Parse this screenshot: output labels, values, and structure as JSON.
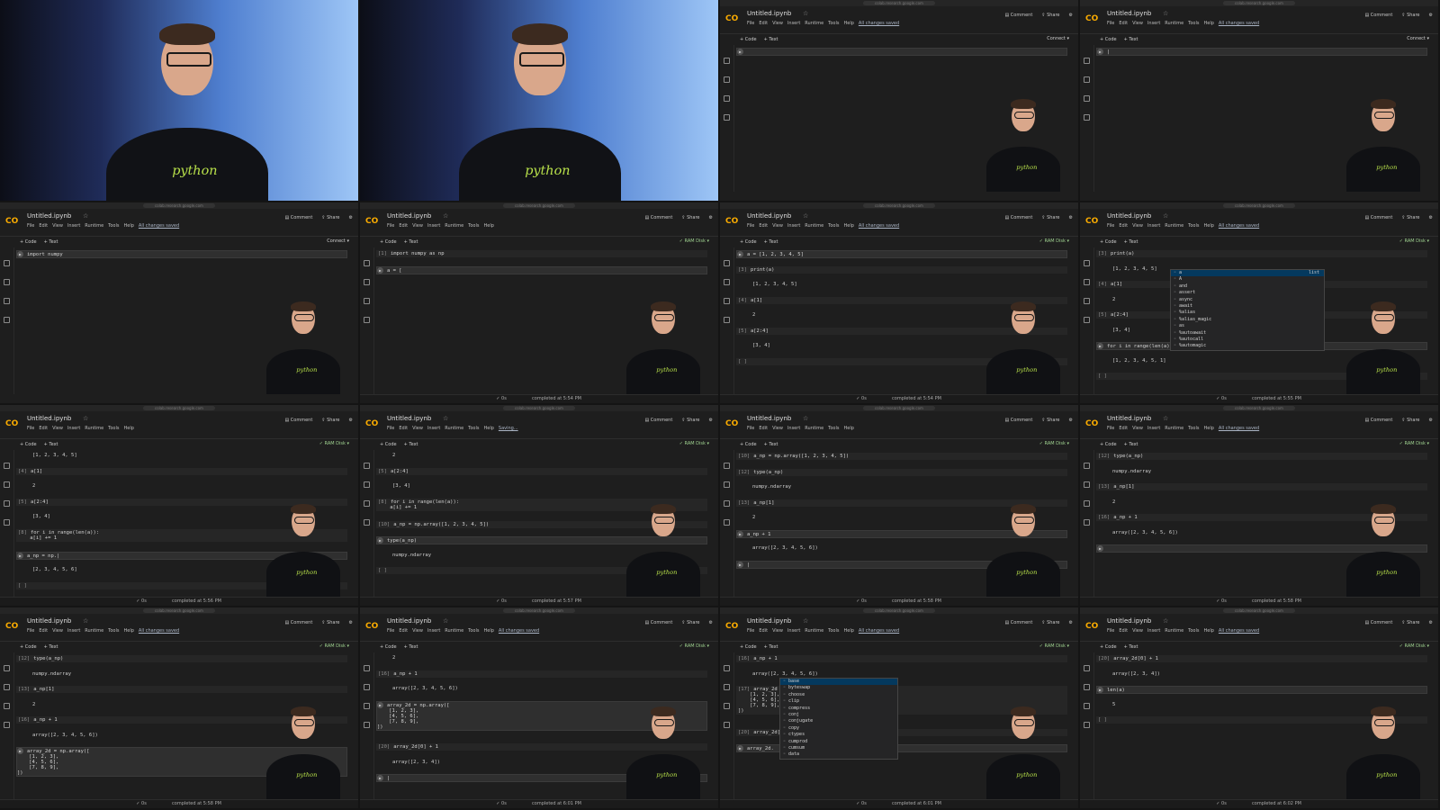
{
  "colab": {
    "title": "Untitled.ipynb",
    "star": "☆",
    "menu": [
      "File",
      "Edit",
      "View",
      "Insert",
      "Runtime",
      "Tools",
      "Help"
    ],
    "toolbar": [
      "+ Code",
      "+ Text"
    ],
    "comment": "Comment",
    "share": "Share",
    "gear": "⚙",
    "ram": "RAM Disk",
    "logo_text": "CO",
    "url": "colab.research.google.com"
  },
  "colors": {
    "accent": "#f9ab00",
    "bg": "#1e1e1e",
    "logo_green": "#b8e04a"
  },
  "frames": [
    {
      "type": "camera",
      "person_x": 0.52
    },
    {
      "type": "camera",
      "person_x": 0.5
    },
    {
      "type": "screen",
      "saved": "All changes saved",
      "connect": "Connect",
      "status": "",
      "time": "",
      "lines": [
        {
          "kind": "active",
          "text": ""
        }
      ]
    },
    {
      "type": "screen",
      "saved": "All changes saved",
      "connect": "Connect",
      "status": "",
      "time": "",
      "lines": [
        {
          "kind": "active",
          "text": "|"
        }
      ]
    },
    {
      "type": "screen",
      "saved": "All changes saved",
      "connect": "Connect",
      "status": "",
      "time": "",
      "lines": [
        {
          "kind": "active",
          "text": "import numpy"
        }
      ]
    },
    {
      "type": "screen",
      "saved": "",
      "connect": "",
      "status": "0s",
      "time": "completed at 5:54 PM",
      "lines": [
        {
          "kind": "code",
          "prompt": "[1]",
          "text": "import numpy as np"
        },
        {
          "kind": "active",
          "text": "a = ["
        }
      ]
    },
    {
      "type": "screen",
      "saved": "All changes saved",
      "connect": "",
      "status": "0s",
      "time": "completed at 5:54 PM",
      "lines": [
        {
          "kind": "active",
          "text": "a = [1, 2, 3, 4, 5]"
        },
        {
          "kind": "code",
          "prompt": "[3]",
          "text": "print(a)"
        },
        {
          "kind": "out",
          "text": "[1, 2, 3, 4, 5]"
        },
        {
          "kind": "code",
          "prompt": "[4]",
          "text": "a[1]"
        },
        {
          "kind": "out",
          "text": "2"
        },
        {
          "kind": "code",
          "prompt": "[5]",
          "text": "a[2:4]"
        },
        {
          "kind": "out",
          "text": "[3, 4]"
        },
        {
          "kind": "code",
          "prompt": "[ ]",
          "text": ""
        }
      ]
    },
    {
      "type": "screen",
      "saved": "All changes saved",
      "connect": "",
      "status": "0s",
      "time": "completed at 5:55 PM",
      "autocomplete": [
        "a",
        "A",
        "and",
        "assert",
        "async",
        "await",
        "%alias",
        "%alias_magic",
        "as",
        "%autoawait",
        "%autocall",
        "%automagic"
      ],
      "autocomplete_tag": "list",
      "lines": [
        {
          "kind": "code",
          "prompt": "[3]",
          "text": "print(a)"
        },
        {
          "kind": "out",
          "text": "[1, 2, 3, 4, 5]"
        },
        {
          "kind": "code",
          "prompt": "[4]",
          "text": "a[1]"
        },
        {
          "kind": "out",
          "text": "2"
        },
        {
          "kind": "code",
          "prompt": "[5]",
          "text": "a[2:4]"
        },
        {
          "kind": "out",
          "text": "[3, 4]"
        },
        {
          "kind": "active",
          "text": "for i in range(len(a)):"
        },
        {
          "kind": "out",
          "text": "[1, 2, 3, 4, 5, 1]"
        },
        {
          "kind": "code",
          "prompt": "[ ]",
          "text": ""
        }
      ]
    },
    {
      "type": "screen",
      "saved": "",
      "connect": "",
      "status": "0s",
      "time": "completed at 5:56 PM",
      "lines": [
        {
          "kind": "out",
          "text": "[1, 2, 3, 4, 5]"
        },
        {
          "kind": "code",
          "prompt": "[4]",
          "text": "a[1]"
        },
        {
          "kind": "out",
          "text": "2"
        },
        {
          "kind": "code",
          "prompt": "[5]",
          "text": "a[2:4]"
        },
        {
          "kind": "out",
          "text": "[3, 4]"
        },
        {
          "kind": "code",
          "prompt": "[8]",
          "text": "for i in range(len(a)):\n    a[i] += 1"
        },
        {
          "kind": "active",
          "text": "a_np = np.|"
        },
        {
          "kind": "out",
          "text": "[2, 3, 4, 5, 6]"
        },
        {
          "kind": "code",
          "prompt": "[ ]",
          "text": ""
        }
      ]
    },
    {
      "type": "screen",
      "saved": "Saving...",
      "connect": "",
      "status": "0s",
      "time": "completed at 5:57 PM",
      "lines": [
        {
          "kind": "out",
          "text": "2"
        },
        {
          "kind": "code",
          "prompt": "[5]",
          "text": "a[2:4]"
        },
        {
          "kind": "out",
          "text": "[3, 4]"
        },
        {
          "kind": "code",
          "prompt": "[8]",
          "text": "for i in range(len(a)):\n    a[i] += 1"
        },
        {
          "kind": "code",
          "prompt": "[10]",
          "text": "a_np = np.array([1, 2, 3, 4, 5])"
        },
        {
          "kind": "active",
          "text": "type(a_np)"
        },
        {
          "kind": "out",
          "text": "numpy.ndarray"
        },
        {
          "kind": "code",
          "prompt": "[ ]",
          "text": ""
        }
      ]
    },
    {
      "type": "screen",
      "saved": "",
      "connect": "",
      "status": "0s",
      "time": "completed at 5:58 PM",
      "lines": [
        {
          "kind": "code",
          "prompt": "[10]",
          "text": "a_np = np.array([1, 2, 3, 4, 5])"
        },
        {
          "kind": "code",
          "prompt": "[12]",
          "text": "type(a_np)"
        },
        {
          "kind": "out",
          "text": "numpy.ndarray"
        },
        {
          "kind": "code",
          "prompt": "[13]",
          "text": "a_np[1]"
        },
        {
          "kind": "out",
          "text": "2"
        },
        {
          "kind": "active",
          "text": "a_np + 1"
        },
        {
          "kind": "out",
          "text": "array([2, 3, 4, 5, 6])"
        },
        {
          "kind": "active",
          "text": "|"
        }
      ]
    },
    {
      "type": "screen",
      "saved": "All changes saved",
      "connect": "",
      "status": "0s",
      "time": "completed at 5:58 PM",
      "lines": [
        {
          "kind": "code",
          "prompt": "[12]",
          "text": "type(a_np)"
        },
        {
          "kind": "out",
          "text": "numpy.ndarray"
        },
        {
          "kind": "code",
          "prompt": "[13]",
          "text": "a_np[1]"
        },
        {
          "kind": "out",
          "text": "2"
        },
        {
          "kind": "code",
          "prompt": "[16]",
          "text": "a_np + 1"
        },
        {
          "kind": "out",
          "text": "array([2, 3, 4, 5, 6])"
        },
        {
          "kind": "active",
          "text": ""
        }
      ]
    },
    {
      "type": "screen",
      "saved": "All changes saved",
      "connect": "",
      "status": "0s",
      "time": "completed at 5:58 PM",
      "lines": [
        {
          "kind": "code",
          "prompt": "[12]",
          "text": "type(a_np)"
        },
        {
          "kind": "out",
          "text": "numpy.ndarray"
        },
        {
          "kind": "code",
          "prompt": "[13]",
          "text": "a_np[1]"
        },
        {
          "kind": "out",
          "text": "2"
        },
        {
          "kind": "code",
          "prompt": "[16]",
          "text": "a_np + 1"
        },
        {
          "kind": "out",
          "text": "array([2, 3, 4, 5, 6])"
        },
        {
          "kind": "active",
          "text": "array_2d = np.array([\n    [1, 2, 3],\n    [4, 5, 6],\n    [7, 8, 9],\n])"
        }
      ]
    },
    {
      "type": "screen",
      "saved": "All changes saved",
      "connect": "",
      "status": "0s",
      "time": "completed at 6:01 PM",
      "lines": [
        {
          "kind": "out",
          "text": "2"
        },
        {
          "kind": "code",
          "prompt": "[16]",
          "text": "a_np + 1"
        },
        {
          "kind": "out",
          "text": "array([2, 3, 4, 5, 6])"
        },
        {
          "kind": "active",
          "text": "array_2d = np.array([\n    [1, 2, 3],\n    [4, 5, 6],\n    [7, 8, 9],\n])"
        },
        {
          "kind": "code",
          "prompt": "[20]",
          "text": "array_2d[0] + 1"
        },
        {
          "kind": "out",
          "text": "array([2, 3, 4])"
        },
        {
          "kind": "active",
          "text": "|"
        }
      ]
    },
    {
      "type": "screen",
      "saved": "All changes saved",
      "connect": "",
      "status": "0s",
      "time": "completed at 6:01 PM",
      "autocomplete": [
        "base",
        "byteswap",
        "choose",
        "clip",
        "compress",
        "conj",
        "conjugate",
        "copy",
        "ctypes",
        "cumprod",
        "cumsum",
        "data"
      ],
      "autocomplete_tag": "",
      "lines": [
        {
          "kind": "code",
          "prompt": "[16]",
          "text": "a_np + 1"
        },
        {
          "kind": "out",
          "text": "array([2, 3, 4, 5, 6])"
        },
        {
          "kind": "code",
          "prompt": "[17]",
          "text": "array_2d = np.array([\n    [1, 2, 3],\n    [4, 5, 6],\n    [7, 8, 9],\n])"
        },
        {
          "kind": "code",
          "prompt": "[20]",
          "text": "array_2d[0] + 1"
        },
        {
          "kind": "active",
          "text": "array_2d."
        }
      ]
    },
    {
      "type": "screen",
      "saved": "All changes saved",
      "connect": "",
      "status": "0s",
      "time": "completed at 6:02 PM",
      "lines": [
        {
          "kind": "code",
          "prompt": "[20]",
          "text": "array_2d[0] + 1"
        },
        {
          "kind": "out",
          "text": "array([2, 3, 4])"
        },
        {
          "kind": "active",
          "text": "len(a)"
        },
        {
          "kind": "out",
          "text": "5"
        },
        {
          "kind": "code",
          "prompt": "[ ]",
          "text": ""
        }
      ]
    }
  ]
}
